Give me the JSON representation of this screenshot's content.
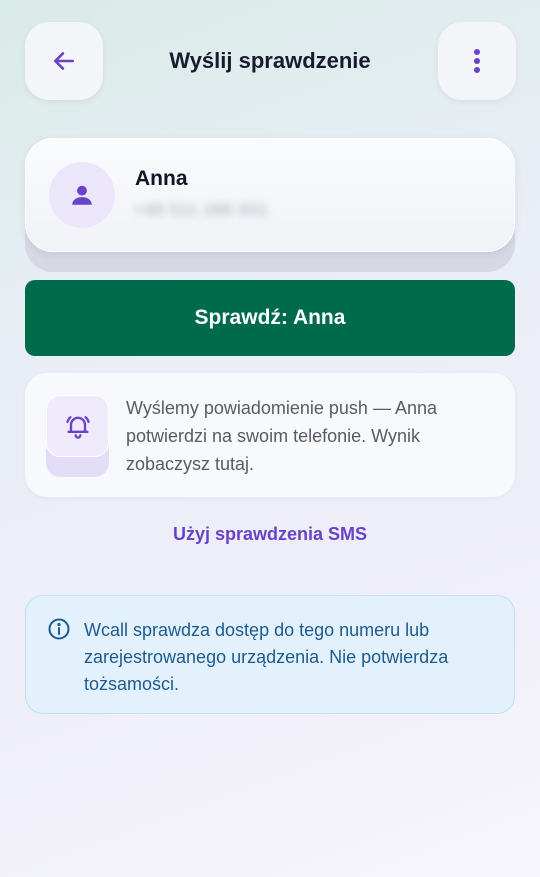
{
  "header": {
    "title": "Wyślij sprawdzenie",
    "back_icon": "arrow-left-icon",
    "menu_icon": "more-vertical-icon"
  },
  "contact": {
    "name": "Anna",
    "phone": "+48 511 288 931",
    "avatar_icon": "person-icon"
  },
  "primary_action": {
    "label": "Sprawdź: Anna"
  },
  "push_info": {
    "icon": "bell-ringing-icon",
    "text": "Wyślemy powiadomienie push — Anna potwierdzi na swoim telefonie. Wynik zobaczysz tutaj."
  },
  "sms_link": {
    "label": "Użyj sprawdzenia SMS"
  },
  "notice": {
    "icon": "info-icon",
    "text": "Wcall sprawdza dostęp do tego numeru lub zarejestrowanego urządzenia. Nie potwierdza tożsamości."
  },
  "colors": {
    "primary": "#006b4a",
    "accent": "#6a42c8",
    "notice_text": "#1d5b8f",
    "notice_bg": "#e3f1fc"
  }
}
